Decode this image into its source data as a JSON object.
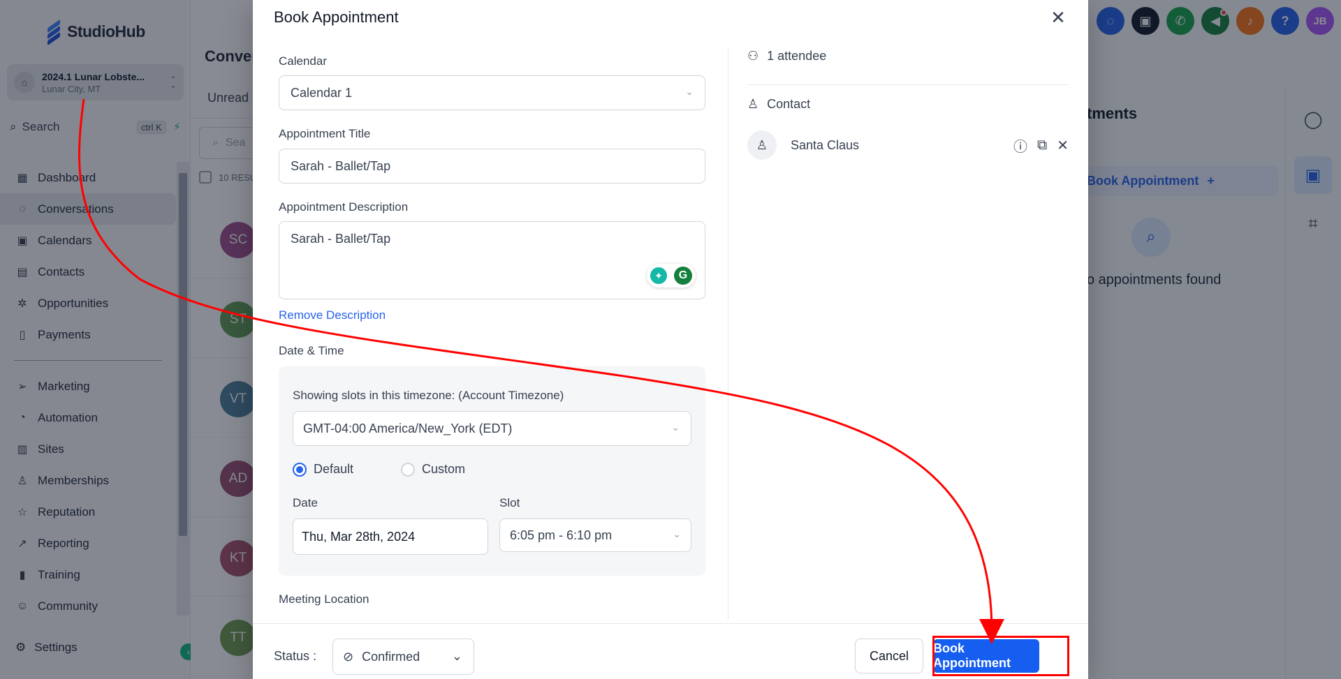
{
  "app": {
    "brand": "StudioHub"
  },
  "account": {
    "name": "2024.1 Lunar Lobste...",
    "location": "Lunar City, MT"
  },
  "search": {
    "label": "Search",
    "shortcut": "ctrl K"
  },
  "nav": {
    "items": [
      {
        "label": "Dashboard",
        "icon": "dashboard-icon"
      },
      {
        "label": "Conversations",
        "icon": "chat-icon",
        "active": true
      },
      {
        "label": "Calendars",
        "icon": "calendar-icon"
      },
      {
        "label": "Contacts",
        "icon": "contacts-icon"
      },
      {
        "label": "Opportunities",
        "icon": "opportunities-icon"
      },
      {
        "label": "Payments",
        "icon": "payments-icon"
      },
      {
        "label": "Marketing",
        "icon": "send-icon"
      },
      {
        "label": "Automation",
        "icon": "automation-icon"
      },
      {
        "label": "Sites",
        "icon": "sites-icon"
      },
      {
        "label": "Memberships",
        "icon": "memberships-icon"
      },
      {
        "label": "Reputation",
        "icon": "star-icon"
      },
      {
        "label": "Reporting",
        "icon": "chart-icon"
      },
      {
        "label": "Training",
        "icon": "book-icon"
      },
      {
        "label": "Community",
        "icon": "community-icon"
      }
    ],
    "settings": "Settings"
  },
  "conversations": {
    "title": "Conver",
    "tab": "Unread",
    "search_placeholder": "Sea",
    "results": "10 RESU",
    "avatars": [
      {
        "initials": "SC",
        "color": "#a14f8d"
      },
      {
        "initials": "ST",
        "color": "#5f9a55"
      },
      {
        "initials": "VT",
        "color": "#4d7e99"
      },
      {
        "initials": "AD",
        "color": "#9a4f73"
      },
      {
        "initials": "KT",
        "color": "#a8506a"
      },
      {
        "initials": "TT",
        "color": "#6e9a4f"
      }
    ]
  },
  "topbar": {
    "user_initials": "JB",
    "icons": [
      "chat-icon",
      "robot-icon",
      "phone-icon",
      "megaphone-icon",
      "bell-icon",
      "help-icon",
      "user-avatar"
    ]
  },
  "right_panel": {
    "title": "tments",
    "book_label": "Book Appointment",
    "empty": "o appointments found"
  },
  "modal": {
    "title": "Book Appointment",
    "calendar_label": "Calendar",
    "calendar_value": "Calendar 1",
    "title_label": "Appointment Title",
    "title_value": "Sarah - Ballet/Tap",
    "description_label": "Appointment Description",
    "description_value": "Sarah - Ballet/Tap",
    "remove_description": "Remove Description",
    "datetime_label": "Date & Time",
    "timezone_label": "Showing slots in this timezone: (Account Timezone)",
    "timezone_value": "GMT-04:00 America/New_York (EDT)",
    "radio_default": "Default",
    "radio_custom": "Custom",
    "selected_mode": "Default",
    "date_label": "Date",
    "date_value": "Thu, Mar 28th, 2024",
    "slot_label": "Slot",
    "slot_value": "6:05 pm - 6:10 pm",
    "meeting_location_label": "Meeting Location",
    "attendees": "1 attendee",
    "contact_label": "Contact",
    "contact_name": "Santa Claus",
    "status_label": "Status :",
    "status_value": "Confirmed",
    "cancel": "Cancel",
    "submit": "Book Appointment"
  },
  "colors": {
    "primary": "#155eef",
    "annotation": "#ff0000",
    "accent_green": "#10b981"
  }
}
